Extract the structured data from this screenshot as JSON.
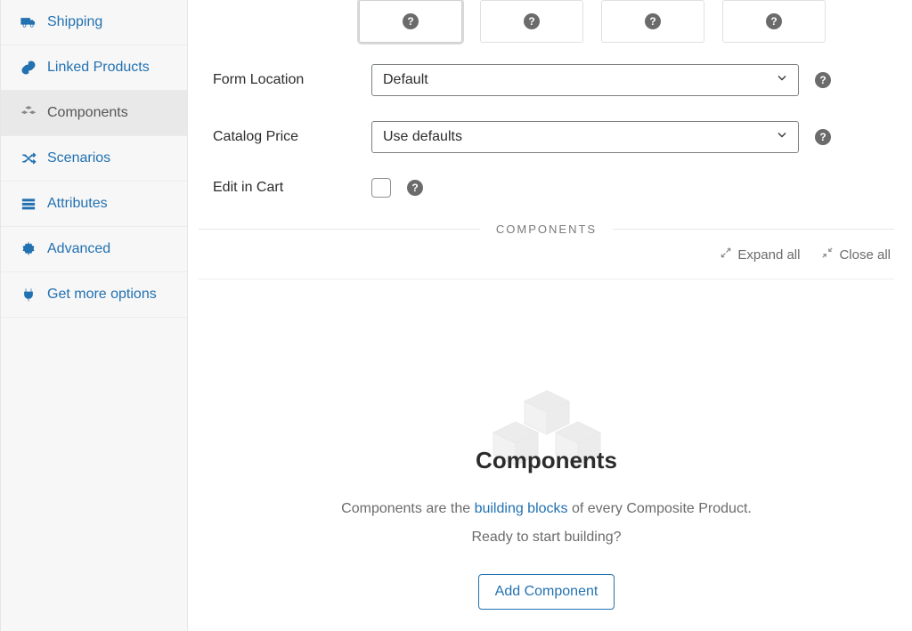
{
  "sidebar": {
    "items": [
      {
        "label": "Shipping"
      },
      {
        "label": "Linked Products"
      },
      {
        "label": "Components"
      },
      {
        "label": "Scenarios"
      },
      {
        "label": "Attributes"
      },
      {
        "label": "Advanced"
      },
      {
        "label": "Get more options"
      }
    ]
  },
  "form": {
    "form_location_label": "Form Location",
    "form_location_value": "Default",
    "catalog_price_label": "Catalog Price",
    "catalog_price_value": "Use defaults",
    "edit_in_cart_label": "Edit in Cart",
    "edit_in_cart_checked": false
  },
  "section": {
    "title": "COMPONENTS",
    "expand_label": "Expand all",
    "close_label": "Close all"
  },
  "empty": {
    "heading": "Components",
    "line1_a": "Components are the ",
    "line1_link": "building blocks",
    "line1_b": " of every Composite Product.",
    "line2": "Ready to start building?",
    "button": "Add Component"
  },
  "glyphs": {
    "help": "?"
  }
}
